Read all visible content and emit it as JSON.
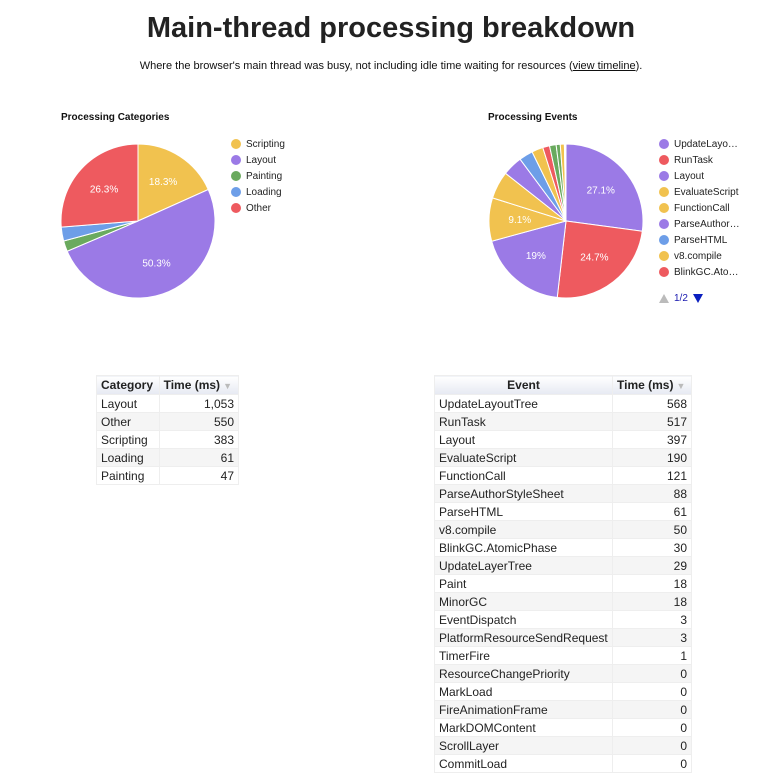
{
  "header": {
    "title": "Main-thread processing breakdown",
    "subtitle_before": "Where the browser's main thread was busy, not including idle time waiting for resources (",
    "subtitle_link": "view timeline",
    "subtitle_after": ")."
  },
  "chart_data": [
    {
      "type": "pie",
      "title": "Processing Categories",
      "legend_position": "right",
      "slices": [
        {
          "label": "Scripting",
          "value": 383,
          "color": "#f1c24f",
          "pct_label": "18.3%"
        },
        {
          "label": "Layout",
          "value": 1053,
          "color": "#9b7ae6",
          "pct_label": "50.3%"
        },
        {
          "label": "Painting",
          "value": 47,
          "color": "#6aaa5e",
          "pct_label": ""
        },
        {
          "label": "Loading",
          "value": 61,
          "color": "#6d9ee8",
          "pct_label": ""
        },
        {
          "label": "Other",
          "value": 550,
          "color": "#ee5a5f",
          "pct_label": "26.3%"
        }
      ]
    },
    {
      "type": "pie",
      "title": "Processing Events",
      "legend_position": "right",
      "legend_page": "1/2",
      "legend_items": [
        "UpdateLayo…",
        "RunTask",
        "Layout",
        "EvaluateScript",
        "FunctionCall",
        "ParseAuthor…",
        "ParseHTML",
        "v8.compile",
        "BlinkGC.Ato…"
      ],
      "slices": [
        {
          "label": "UpdateLayoutTree",
          "value": 568,
          "color": "#9b7ae6",
          "pct_label": "27.1%"
        },
        {
          "label": "RunTask",
          "value": 517,
          "color": "#ee5a5f",
          "pct_label": "24.7%"
        },
        {
          "label": "Layout",
          "value": 397,
          "color": "#9b7ae6",
          "pct_label": "19%"
        },
        {
          "label": "EvaluateScript",
          "value": 190,
          "color": "#f1c24f",
          "pct_label": "9.1%"
        },
        {
          "label": "FunctionCall",
          "value": 121,
          "color": "#f1c24f",
          "pct_label": ""
        },
        {
          "label": "ParseAuthorStyleSheet",
          "value": 88,
          "color": "#9b7ae6",
          "pct_label": ""
        },
        {
          "label": "ParseHTML",
          "value": 61,
          "color": "#6d9ee8",
          "pct_label": ""
        },
        {
          "label": "v8.compile",
          "value": 50,
          "color": "#f1c24f",
          "pct_label": ""
        },
        {
          "label": "BlinkGC.AtomicPhase",
          "value": 30,
          "color": "#ee5a5f",
          "pct_label": ""
        },
        {
          "label": "UpdateLayerTree",
          "value": 29,
          "color": "#6aaa5e",
          "pct_label": ""
        },
        {
          "label": "Paint",
          "value": 18,
          "color": "#6aaa5e",
          "pct_label": ""
        },
        {
          "label": "MinorGC",
          "value": 18,
          "color": "#f1c24f",
          "pct_label": ""
        },
        {
          "label": "EventDispatch",
          "value": 3,
          "color": "#9b7ae6",
          "pct_label": ""
        },
        {
          "label": "PlatformResourceSendRequest",
          "value": 3,
          "color": "#6d9ee8",
          "pct_label": ""
        },
        {
          "label": "TimerFire",
          "value": 1,
          "color": "#f1c24f",
          "pct_label": ""
        }
      ]
    }
  ],
  "tables": {
    "categories": {
      "headers": [
        "Category",
        "Time (ms)"
      ],
      "rows": [
        [
          "Layout",
          "1,053"
        ],
        [
          "Other",
          "550"
        ],
        [
          "Scripting",
          "383"
        ],
        [
          "Loading",
          "61"
        ],
        [
          "Painting",
          "47"
        ]
      ]
    },
    "events": {
      "headers": [
        "Event",
        "Time (ms)"
      ],
      "rows": [
        [
          "UpdateLayoutTree",
          "568"
        ],
        [
          "RunTask",
          "517"
        ],
        [
          "Layout",
          "397"
        ],
        [
          "EvaluateScript",
          "190"
        ],
        [
          "FunctionCall",
          "121"
        ],
        [
          "ParseAuthorStyleSheet",
          "88"
        ],
        [
          "ParseHTML",
          "61"
        ],
        [
          "v8.compile",
          "50"
        ],
        [
          "BlinkGC.AtomicPhase",
          "30"
        ],
        [
          "UpdateLayerTree",
          "29"
        ],
        [
          "Paint",
          "18"
        ],
        [
          "MinorGC",
          "18"
        ],
        [
          "EventDispatch",
          "3"
        ],
        [
          "PlatformResourceSendRequest",
          "3"
        ],
        [
          "TimerFire",
          "1"
        ],
        [
          "ResourceChangePriority",
          "0"
        ],
        [
          "MarkLoad",
          "0"
        ],
        [
          "FireAnimationFrame",
          "0"
        ],
        [
          "MarkDOMContent",
          "0"
        ],
        [
          "ScrollLayer",
          "0"
        ],
        [
          "CommitLoad",
          "0"
        ]
      ]
    },
    "sort_icon": "sort-desc-icon"
  }
}
